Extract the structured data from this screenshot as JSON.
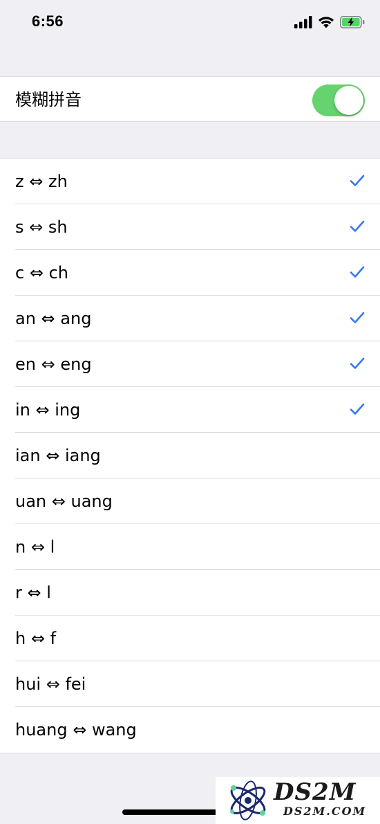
{
  "status_bar": {
    "time": "6:56",
    "icons": [
      "signal-icon",
      "wifi-icon",
      "battery-charging-icon"
    ]
  },
  "fuzzy_pinyin": {
    "label": "模糊拼音",
    "enabled": true,
    "toggle_color": "#65d36e"
  },
  "options": [
    {
      "label": "z ⇔ zh",
      "checked": true
    },
    {
      "label": "s ⇔ sh",
      "checked": true
    },
    {
      "label": "c ⇔ ch",
      "checked": true
    },
    {
      "label": "an ⇔ ang",
      "checked": true
    },
    {
      "label": "en ⇔ eng",
      "checked": true
    },
    {
      "label": "in ⇔ ing",
      "checked": true
    },
    {
      "label": "ian ⇔ iang",
      "checked": false
    },
    {
      "label": "uan ⇔ uang",
      "checked": false
    },
    {
      "label": "n ⇔ l",
      "checked": false
    },
    {
      "label": "r ⇔ l",
      "checked": false
    },
    {
      "label": "h ⇔ f",
      "checked": false
    },
    {
      "label": "hui ⇔ fei",
      "checked": false
    },
    {
      "label": "huang ⇔ wang",
      "checked": false
    }
  ],
  "check_color": "#3478f6",
  "watermark": {
    "main": "DS2M",
    "sub": "DS2M.COM"
  }
}
